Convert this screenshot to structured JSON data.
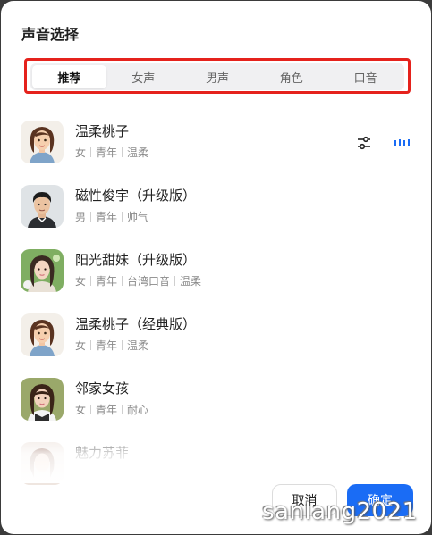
{
  "dialog": {
    "title": "声音选择"
  },
  "tabs": [
    {
      "label": "推荐",
      "active": true
    },
    {
      "label": "女声",
      "active": false
    },
    {
      "label": "男声",
      "active": false
    },
    {
      "label": "角色",
      "active": false
    },
    {
      "label": "口音",
      "active": false
    }
  ],
  "voices": [
    {
      "name": "温柔桃子",
      "tags": [
        "女",
        "青年",
        "温柔"
      ],
      "avatar": "cartoon-woman",
      "selected": true
    },
    {
      "name": "磁性俊宇（升级版）",
      "tags": [
        "男",
        "青年",
        "帅气"
      ],
      "avatar": "young-man"
    },
    {
      "name": "阳光甜妹（升级版）",
      "tags": [
        "女",
        "青年",
        "台湾口音",
        "温柔"
      ],
      "avatar": "young-woman-flowers"
    },
    {
      "name": "温柔桃子（经典版）",
      "tags": [
        "女",
        "青年",
        "温柔"
      ],
      "avatar": "cartoon-woman"
    },
    {
      "name": "邻家女孩",
      "tags": [
        "女",
        "青年",
        "耐心"
      ],
      "avatar": "girl-next-door"
    },
    {
      "name": "魅力苏菲",
      "tags": [],
      "avatar": "charming-woman"
    }
  ],
  "buttons": {
    "cancel": "取消",
    "confirm": "确定"
  },
  "watermark": "sanlang2021",
  "colors": {
    "accent": "#1a6cf5",
    "highlight_outline": "#e5221c"
  }
}
